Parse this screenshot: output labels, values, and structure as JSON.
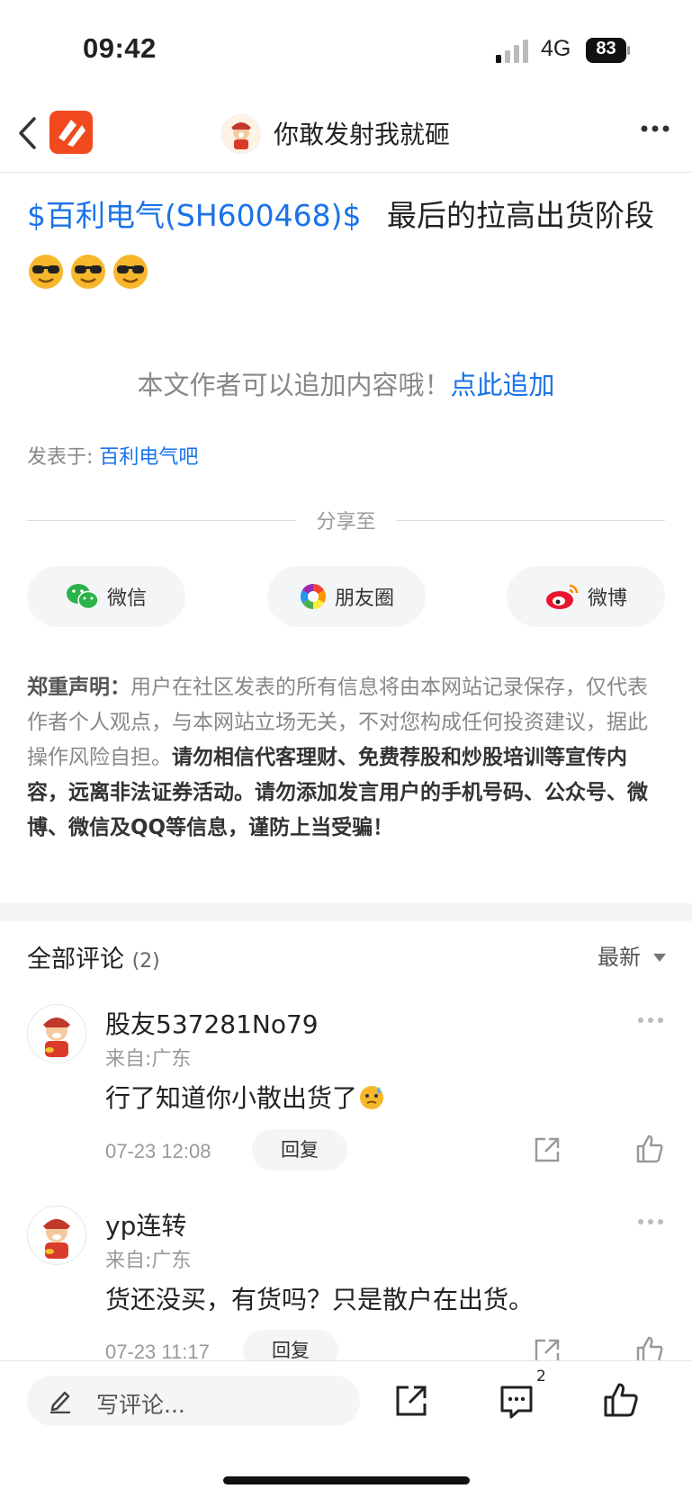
{
  "status_bar": {
    "time": "09:42",
    "network": "4G",
    "battery": "83"
  },
  "header": {
    "title": "你敢发射我就砸"
  },
  "post": {
    "tag": "$百利电气(SH600468)$",
    "text": "最后的拉高出货阶段",
    "emoji": "sunglasses-emoji"
  },
  "append": {
    "prompt": "本文作者可以追加内容哦！",
    "link": "点此追加"
  },
  "posted_in": {
    "label": "发表于: ",
    "forum": "百利电气吧"
  },
  "share": {
    "label": "分享至",
    "buttons": [
      {
        "label": "微信",
        "icon": "wechat-icon"
      },
      {
        "label": "朋友圈",
        "icon": "moments-icon"
      },
      {
        "label": "微博",
        "icon": "weibo-icon"
      }
    ]
  },
  "disclaimer": {
    "title": "郑重声明：",
    "normal": "用户在社区发表的所有信息将由本网站记录保存，仅代表作者个人观点，与本网站立场无关，不对您构成任何投资建议，据此操作风险自担。",
    "bold": "请勿相信代客理财、免费荐股和炒股培训等宣传内容，远离非法证券活动。请勿添加发言用户的手机号码、公众号、微博、微信及QQ等信息，谨防上当受骗！"
  },
  "comments_header": {
    "title": "全部评论",
    "count": "(2)",
    "sort": "最新"
  },
  "comments": [
    {
      "name": "股友537281No79",
      "location": "来自:广东",
      "text": "行了知道你小散出货了",
      "time": "07-23 12:08",
      "reply": "回复"
    },
    {
      "name": "yp连转",
      "location": "来自:广东",
      "text": "货还没买，有货吗？只是散户在出货。",
      "time": "07-23 11:17",
      "reply": "回复"
    }
  ],
  "bottom_bar": {
    "placeholder": "写评论...",
    "comment_count": "2"
  },
  "colors": {
    "link": "#1a73e8",
    "brand": "#f04a1e"
  }
}
